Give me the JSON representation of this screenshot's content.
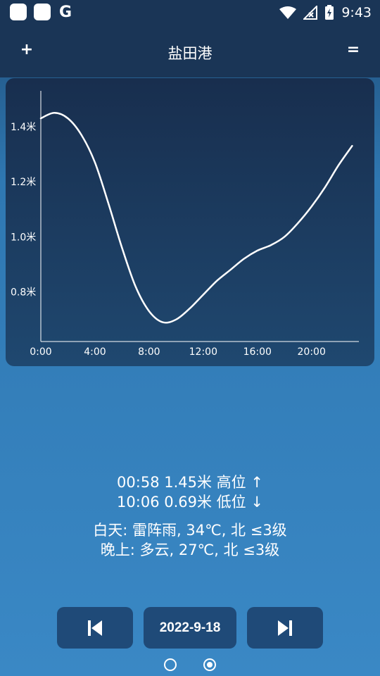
{
  "status_bar": {
    "time": "9:43"
  },
  "app_bar": {
    "add_label": "+",
    "title": "盐田港",
    "menu_label": "="
  },
  "chart_data": {
    "type": "line",
    "title": "",
    "xlabel": "",
    "ylabel": "",
    "x_ticks": [
      "0:00",
      "4:00",
      "8:00",
      "12:00",
      "16:00",
      "20:00"
    ],
    "y_ticks": [
      "0.8米",
      "1.0米",
      "1.2米",
      "1.4米"
    ],
    "y_tick_values": [
      0.8,
      1.0,
      1.2,
      1.4
    ],
    "xlim": [
      0,
      23.5
    ],
    "ylim": [
      0.62,
      1.53
    ],
    "series": [
      {
        "color": "#ffffff",
        "x": [
          0,
          1,
          2,
          3,
          4,
          5,
          6,
          7,
          8,
          9,
          10,
          11,
          12,
          13,
          14,
          15,
          16,
          17,
          18,
          19,
          20,
          21,
          22,
          23
        ],
        "y": [
          1.43,
          1.45,
          1.43,
          1.37,
          1.27,
          1.12,
          0.96,
          0.82,
          0.73,
          0.69,
          0.7,
          0.74,
          0.79,
          0.84,
          0.88,
          0.92,
          0.95,
          0.97,
          1.0,
          1.05,
          1.11,
          1.18,
          1.26,
          1.33
        ]
      }
    ]
  },
  "tides": {
    "high": "00:58   1.45米   高位 ↑",
    "low": "10:06   0.69米   低位 ↓"
  },
  "weather": {
    "day": "白天: 雷阵雨, 34℃, 北 ≤3级",
    "night": "晚上: 多云, 27℃, 北 ≤3级"
  },
  "navigation": {
    "date": "2022-9-18",
    "prev_icon": "skip-previous-icon",
    "next_icon": "skip-next-icon"
  },
  "pager": {
    "pages": 2,
    "active": 1
  }
}
